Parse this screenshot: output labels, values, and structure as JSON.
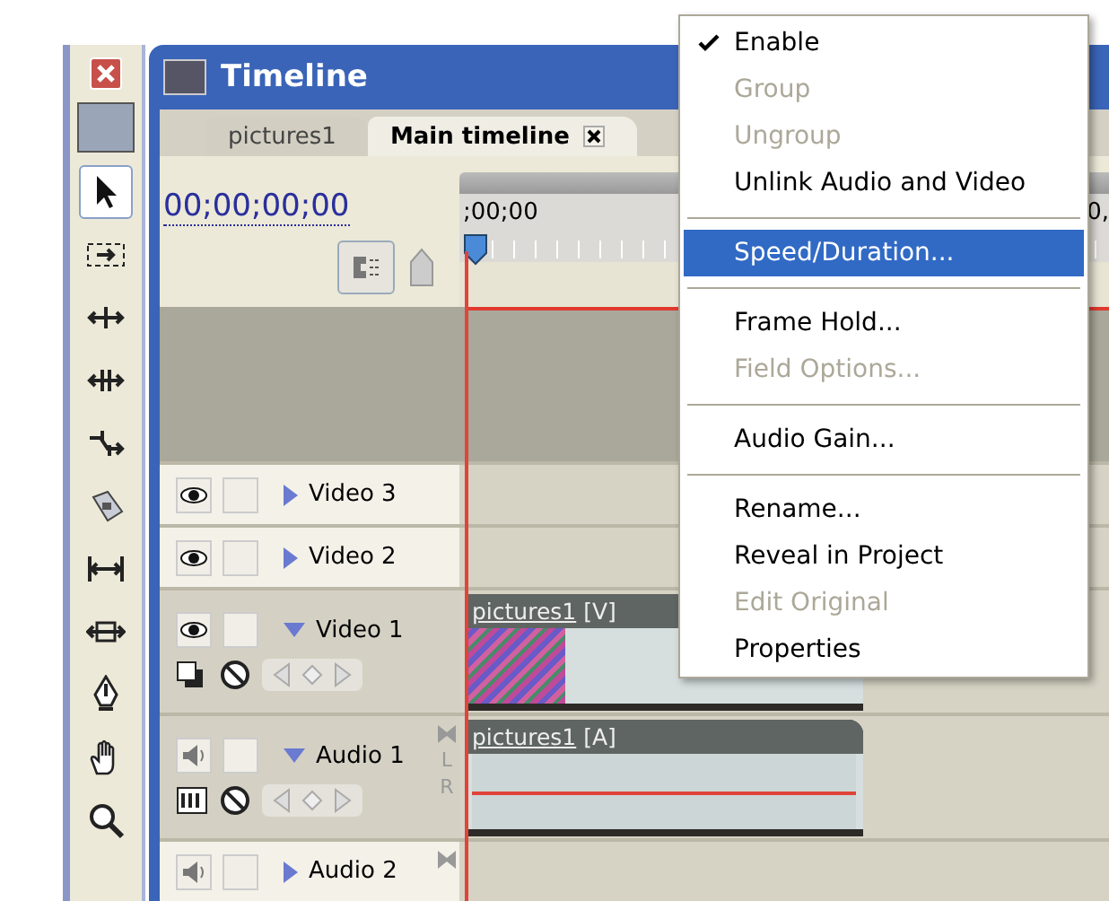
{
  "palette": {
    "tools": [
      {
        "kind": "selection",
        "selected": true
      },
      {
        "kind": "track-select",
        "selected": false
      },
      {
        "kind": "ripple",
        "selected": false
      },
      {
        "kind": "rolling",
        "selected": false
      },
      {
        "kind": "rate-stretch",
        "selected": false
      },
      {
        "kind": "razor",
        "selected": false
      },
      {
        "kind": "slip",
        "selected": false
      },
      {
        "kind": "slide",
        "selected": false
      },
      {
        "kind": "pen",
        "selected": false
      },
      {
        "kind": "hand",
        "selected": false
      },
      {
        "kind": "zoom",
        "selected": false
      }
    ]
  },
  "window": {
    "title": "Timeline"
  },
  "tabs": [
    {
      "label": "pictures1",
      "selected": false,
      "closable": false
    },
    {
      "label": "Main timeline",
      "selected": true,
      "closable": true
    }
  ],
  "timecode": "00;00;00;00",
  "ruler": {
    "labels": [
      ";00;00",
      "0,"
    ]
  },
  "tracks": [
    {
      "name": "Video 3",
      "kind": "video",
      "expanded": false
    },
    {
      "name": "Video 2",
      "kind": "video",
      "expanded": false
    },
    {
      "name": "Video 1",
      "kind": "video",
      "expanded": true,
      "clip": {
        "name": "pictures1",
        "tag": "[V]"
      }
    },
    {
      "name": "Audio 1",
      "kind": "audio",
      "expanded": true,
      "channels": [
        "L",
        "R"
      ],
      "clip": {
        "name": "pictures1",
        "tag": "[A]"
      }
    },
    {
      "name": "Audio 2",
      "kind": "audio",
      "expanded": false
    }
  ],
  "menu": {
    "groups": [
      {
        "items": [
          {
            "label": "Enable",
            "checked": true,
            "disabled": false,
            "selected": false
          },
          {
            "label": "Group",
            "checked": false,
            "disabled": true,
            "selected": false
          },
          {
            "label": "Ungroup",
            "checked": false,
            "disabled": true,
            "selected": false
          },
          {
            "label": "Unlink Audio and Video",
            "checked": false,
            "disabled": false,
            "selected": false
          }
        ]
      },
      {
        "items": [
          {
            "label": "Speed/Duration...",
            "checked": false,
            "disabled": false,
            "selected": true
          }
        ]
      },
      {
        "items": [
          {
            "label": "Frame Hold...",
            "checked": false,
            "disabled": false,
            "selected": false
          },
          {
            "label": "Field Options...",
            "checked": false,
            "disabled": true,
            "selected": false
          }
        ]
      },
      {
        "items": [
          {
            "label": "Audio Gain...",
            "checked": false,
            "disabled": false,
            "selected": false
          }
        ]
      },
      {
        "items": [
          {
            "label": "Rename...",
            "checked": false,
            "disabled": false,
            "selected": false
          },
          {
            "label": "Reveal in Project",
            "checked": false,
            "disabled": false,
            "selected": false
          },
          {
            "label": "Edit Original",
            "checked": false,
            "disabled": true,
            "selected": false
          },
          {
            "label": "Properties",
            "checked": false,
            "disabled": false,
            "selected": false
          }
        ]
      }
    ]
  }
}
